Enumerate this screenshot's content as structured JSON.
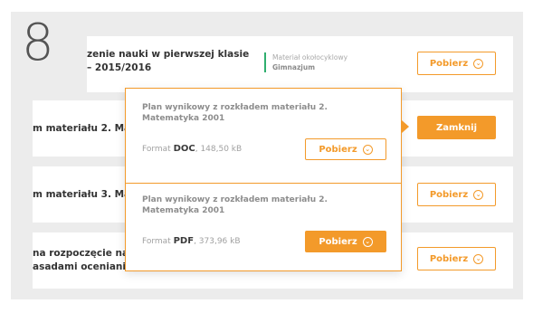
{
  "step_number": "8",
  "rows": [
    {
      "title": "zenie nauki w pierwszej klasie\n– 2015/2016",
      "type_label": "Materiał okołocyklowy",
      "type_level": "Gimnazjum",
      "button": "Pobierz"
    },
    {
      "title": "m materiału 2. Ma",
      "button": "Zamknij"
    },
    {
      "title": "m materiału 3. Ma",
      "button": "Pobierz"
    },
    {
      "title": " na rozpoczęcie na\nasadami oceniani",
      "button": "Pobierz"
    }
  ],
  "popup": {
    "files": [
      {
        "title": "Plan wynikowy z rozkładem materiału 2.\nMatematyka 2001",
        "format_prefix": "Format",
        "format": "DOC",
        "size": ", 148,50 kB",
        "button": "Pobierz"
      },
      {
        "title": "Plan wynikowy z rozkładem materiału 2.\nMatematyka 2001",
        "format_prefix": "Format",
        "format": "PDF",
        "size": ", 373,96 kB",
        "button": "Pobierz"
      }
    ]
  },
  "colors": {
    "accent": "#f39a2a",
    "green_bar": "#2fae6e",
    "panel_bg": "#ececec"
  },
  "icons": {
    "download": "download-circle-icon"
  }
}
